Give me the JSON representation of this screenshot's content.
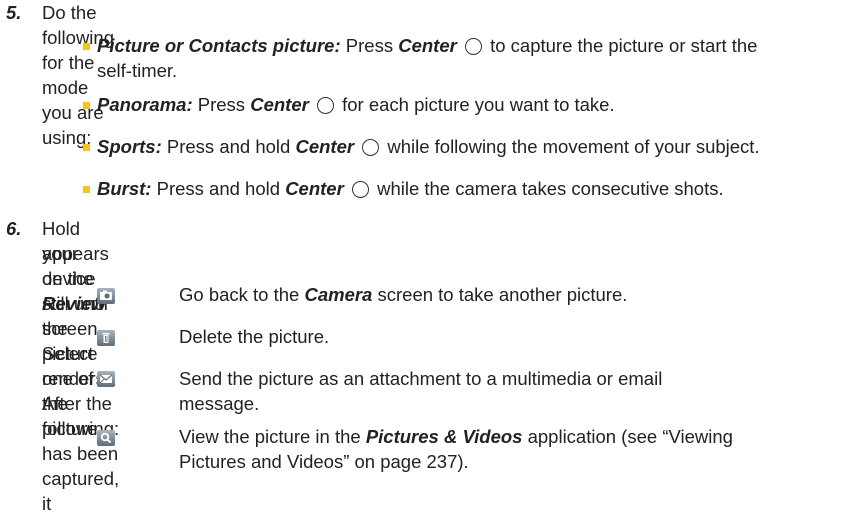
{
  "step5": {
    "number": "5.",
    "intro": "Do the following for the mode you are using:",
    "modes": [
      {
        "label": "Picture or Contacts picture:",
        "before": "Press",
        "key": "Center",
        "after_line1": "to capture the picture or start the",
        "line2": "self-timer."
      },
      {
        "label": "Panorama:",
        "before": "Press",
        "key": "Center",
        "after": "for each picture you want to take."
      },
      {
        "label": "Sports:",
        "before": "Press and hold",
        "key": "Center",
        "after": "while following the movement of your subject."
      },
      {
        "label": "Burst:",
        "before": "Press and hold",
        "key": "Center",
        "after": "while the camera takes consecutive shots."
      }
    ]
  },
  "step6": {
    "number": "6.",
    "line1": "Hold your device still until the picture renders. After the picture has been captured, it",
    "line2_before": "appears on the",
    "line2_em": "Review",
    "line2_after": "screen. Select one of the following:",
    "options": [
      {
        "icon": "camera-icon",
        "before": "Go back to the",
        "em": "Camera",
        "after": "screen to take another picture."
      },
      {
        "icon": "trash-icon",
        "text": "Delete the picture."
      },
      {
        "icon": "envelope-icon",
        "line1": "Send the picture as an attachment to a multimedia or email",
        "line2": "message."
      },
      {
        "icon": "magnifier-icon",
        "before": "View the picture in the",
        "em": "Pictures & Videos",
        "after": "application (see “Viewing",
        "line2": "Pictures and Videos” on page 237)."
      }
    ]
  }
}
